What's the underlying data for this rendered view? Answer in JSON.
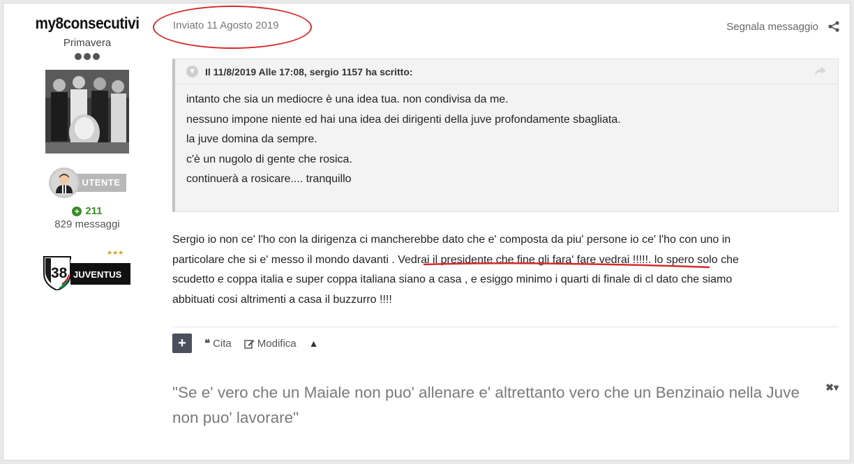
{
  "author": {
    "name": "my8consecutivi",
    "rank": "Primavera",
    "badge_label": "UTENTE",
    "reputation": "211",
    "post_count": "829 messaggi",
    "club_logo_text": "JUVENTUS",
    "club_number": "38"
  },
  "post": {
    "date": "Inviato 11 Agosto 2019",
    "report_label": "Segnala messaggio",
    "quote": {
      "header": "Il 11/8/2019 Alle 17:08, sergio 1157 ha scritto:",
      "lines": [
        "intanto che sia un mediocre è una idea tua. non condivisa da me.",
        "nessuno impone niente ed hai una idea dei dirigenti della juve profondamente sbagliata.",
        "la juve domina da sempre.",
        "c'è un nugolo di gente che rosica.",
        "continuerà a rosicare.... tranquillo"
      ]
    },
    "body": {
      "line1": "Sergio io non ce' l'ho con la dirigenza ci mancherebbe dato che e' composta da piu' persone  io ce' l'ho con uno in",
      "line2_before": "particolare che si e' messo il mondo davanti . ",
      "line2_underlined": "Vedrai il presidente che fine gli fara' fare vedrai !!!!!.",
      "line2_after": " lo spero solo che",
      "line3": "scudetto e coppa italia e super coppa italiana siano a casa , e esiggo minimo i quarti di finale di cl dato che siamo",
      "line4": "abbituati cosi altrimenti a casa il buzzurro !!!!"
    },
    "actions": {
      "plus": "+",
      "quote_label": "Cita",
      "edit_label": "Modifica",
      "up_arrow": "▲"
    },
    "signature": "\"Se e' vero che un Maiale non puo' allenare e' altrettanto vero che un Benzinaio nella Juve non puo' lavorare\"",
    "signature_controls": "✖▾"
  },
  "colors": {
    "annotation_red": "#d42b2b",
    "reputation_green": "#3b8d2b",
    "button_dark": "#4b4f5c"
  }
}
